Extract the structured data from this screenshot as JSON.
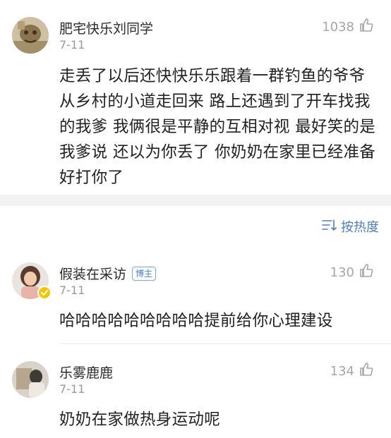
{
  "comments": [
    {
      "username": "肥宅快乐刘同学",
      "date": "7-11",
      "likes": "1038",
      "text": "走丢了以后还快快乐乐跟着一群钓鱼的爷爷从乡村的小道走回来  路上还遇到了开车找我的我爹  我俩很是平静的互相对视  最好笑的是我爹说  还以为你丢了  你奶奶在家里已经准备好打你了"
    },
    {
      "username": "假装在采访",
      "badge": "博主",
      "date": "7-11",
      "likes": "130",
      "text": "哈哈哈哈哈哈哈哈哈提前给你心理建设"
    },
    {
      "username": "乐雾鹿鹿",
      "date": "7-11",
      "likes": "134",
      "text": "奶奶在家做热身运动呢"
    }
  ],
  "sort": {
    "label": "按热度",
    "icon": "sort-icon"
  },
  "icons": {
    "like": "thumbs-up-icon",
    "verified": "verified-badge-icon"
  },
  "colors": {
    "accent": "#4f7fbf",
    "muted": "#9a9a9a",
    "separator": "#f2f2f2",
    "verified": "#f5c400"
  }
}
